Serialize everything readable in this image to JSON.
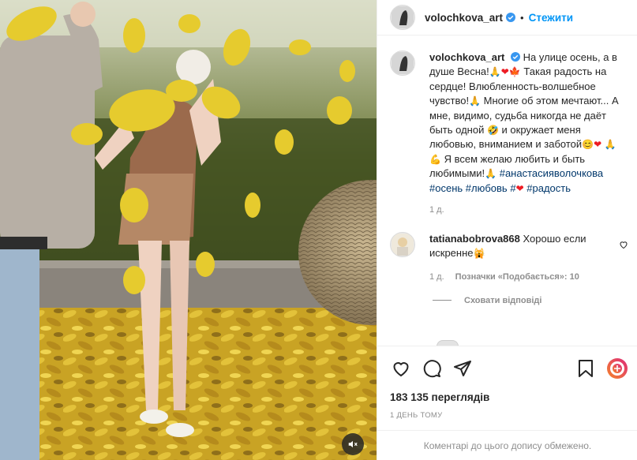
{
  "header": {
    "username": "volochkova_art",
    "separator": "•",
    "follow_label": "Стежити"
  },
  "caption": {
    "username": "volochkova_art",
    "lines": [
      "На улице осень, а в",
      "душе Весна!",
      "Такая радость на",
      "сердце! Влюбленность-волшебное",
      "чувство!",
      "Многие об этом мечтают...",
      "А мне, видимо, судьба никогда не даёт",
      "быть одной",
      "и окружает меня",
      "любовью, вниманием и заботой",
      "Я всем желаю любить и быть",
      "любимыми!",
      "#анастасияволочкова",
      "#осень",
      "#любовь",
      "#",
      "#радость"
    ],
    "time": "1 д."
  },
  "comment": {
    "username": "tatianabobrova868",
    "text": "Хорошо если",
    "text2": "искренне",
    "time": "1 д.",
    "likes": "Позначки «Подобається»: 10",
    "hide_replies": "Сховати відповіді"
  },
  "stats": {
    "views": "183 135 переглядів",
    "posted": "1 ДЕНЬ ТОМУ",
    "comments_limited": "Коментарі до цього допису обмежено."
  },
  "icons": {
    "like": "heart-outline-icon",
    "comment": "speech-bubble-icon",
    "share": "paper-plane-icon",
    "save": "bookmark-icon",
    "gift": "gift-badge-icon",
    "mute": "speaker-muted-icon",
    "verified": "verified-badge-icon"
  },
  "colors": {
    "link": "#00376b",
    "follow": "#0095f6",
    "verified": "#3897f0",
    "heart_emoji": "#ed1c24",
    "badge_gradient_start": "#f58529",
    "badge_gradient_end": "#dd2a7b"
  }
}
